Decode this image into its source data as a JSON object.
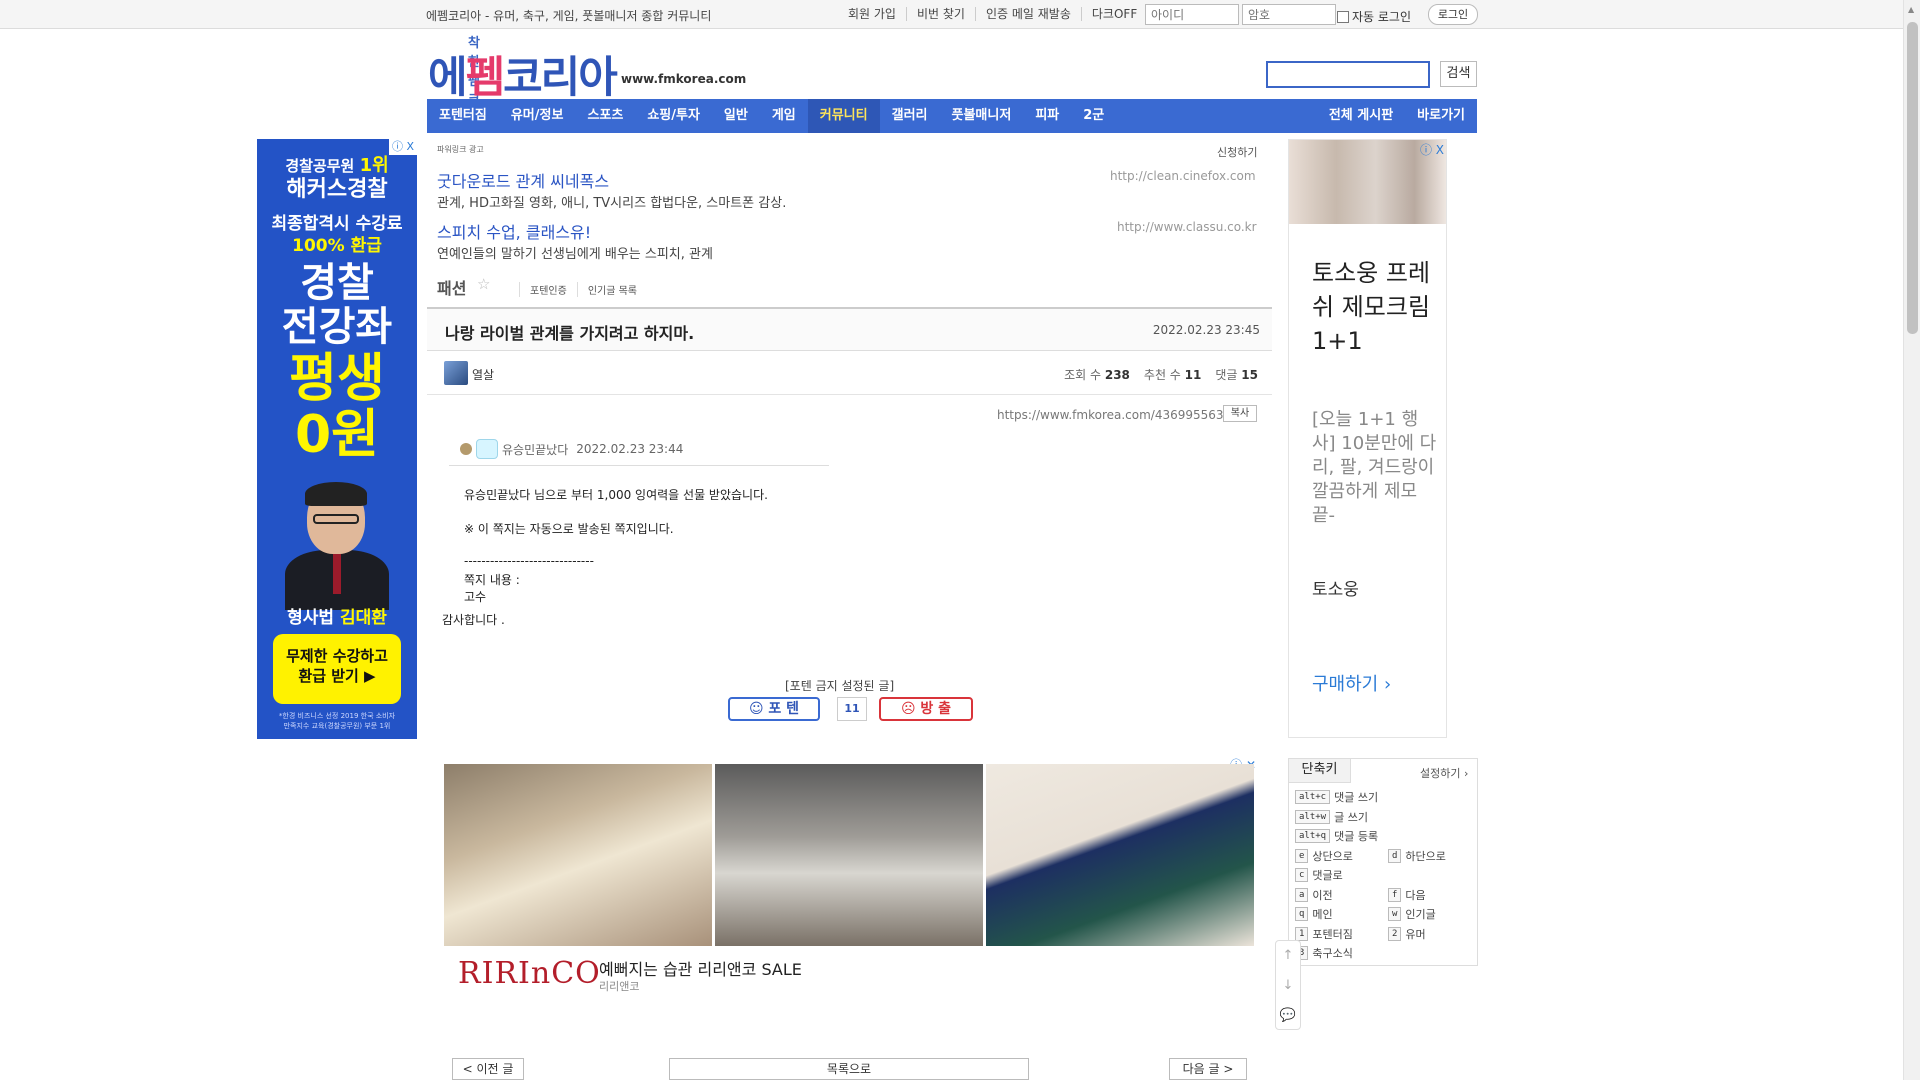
{
  "topbar": {
    "site_desc": "에펨코리아 - 유머, 축구, 게임, 풋볼매니저 종합 커뮤니티",
    "links": [
      "회원 가입",
      "비번 찾기",
      "인증 메일 재발송",
      "다크OFF"
    ],
    "id_placeholder": "아이디",
    "pw_placeholder": "암호",
    "autologin": "자동 로그인",
    "login": "로그인"
  },
  "logo": {
    "sub": "착한 펨코",
    "main_a": "에",
    "main_b": "펨",
    "main_c": "코리아",
    "url": "www.fmkorea.com"
  },
  "search": {
    "button": "검색"
  },
  "nav": {
    "items": [
      "포텐터짐",
      "유머/정보",
      "스포츠",
      "쇼핑/투자",
      "일반",
      "게임",
      "커뮤니티",
      "갤러리",
      "풋볼매니저",
      "피파",
      "2군"
    ],
    "active_index": 6,
    "right": [
      "전체 게시판",
      "바로가기"
    ]
  },
  "left_ad": {
    "close": "ⓘ X",
    "line1": "경찰공무원",
    "line1b": "1위",
    "line2": "해커스경찰",
    "line3": "최종합격시 수강료",
    "line4": "100% 환급",
    "line5a": "경찰",
    "line5b": "전강좌",
    "line6a": "평생",
    "line6b": "0원",
    "name_a": "형사법 ",
    "name_b": "김대환",
    "cta_a": "무제한 수강하고",
    "cta_b": "환급 받기 ▶",
    "fine_a": "*한경 비즈니스 선정 2019 한국 소비자",
    "fine_b": "만족지수 교육(경찰공무원) 부문 1위"
  },
  "powerlink": {
    "label": "파워링크 광고",
    "apply": "신청하기",
    "ads": [
      {
        "title": "굿다운로드 관계 씨네폭스",
        "desc": "관계, HD고화질 영화, 애니, TV시리즈 합법다운, 스마트폰 감상.",
        "url": "http://clean.cinefox.com"
      },
      {
        "title": "스피치 수업, 클래스유!",
        "desc": "연예인들의 말하기 선생님에게 배우는 스피치, 관계",
        "url": "http://www.classu.co.kr"
      }
    ]
  },
  "board": {
    "name": "패션",
    "links": [
      "포텐인증",
      "인기글 목록"
    ]
  },
  "post": {
    "title": "나랑 라이벌 관계를 가지려고 하지마.",
    "date": "2022.02.23 23:45",
    "author": "열살",
    "views_label": "조회 수",
    "views": "238",
    "likes_label": "추천 수",
    "likes": "11",
    "comments_label": "댓글",
    "comments": "15",
    "permalink": "https://www.fmkorea.com/4369955632",
    "copy": "복사",
    "msg_sender": "유승민끝났다",
    "msg_date": "2022.02.23 23:44",
    "lines": [
      "유승민끝났다 님으로 부터 1,000 잉여력을 선물 받았습니다.",
      "※ 이 쪽지는 자동으로 발송된 쪽지입니다.",
      "------------------------------",
      "쪽지 내용 :",
      "고수",
      "감사합니다 ."
    ]
  },
  "vote": {
    "label": "[포텐 금지 설정된 글]",
    "up": "포 텐",
    "count": "11",
    "down": "방 출"
  },
  "shop_ad": {
    "logo": "RIRInCO",
    "title": "예뻐지는 습관 리리앤코 SALE",
    "sub": "리리앤코"
  },
  "post_nav": {
    "prev": "< 이전 글",
    "list": "목록으로",
    "next": "다음 글 >"
  },
  "right_ad": {
    "close": "ⓘ X",
    "big": "토소웅 프레쉬 제모크림 1+1",
    "desc": "[오늘 1+1 행사] 10분만에 다리, 팔, 겨드랑이 깔끔하게 제모 끝-",
    "brand": "토소웅",
    "buy": "구매하기 ›"
  },
  "shortcut": {
    "tab": "단축키",
    "setting": "설정하기 ›",
    "rows": [
      {
        "key": "alt+c",
        "label": "댓글 쓰기"
      },
      {
        "key": "alt+w",
        "label": "글 쓰기"
      },
      {
        "key": "alt+q",
        "label": "댓글 등록"
      },
      {
        "key": "e",
        "label": "상단으로",
        "key2": "d",
        "label2": "하단으로"
      },
      {
        "key": "c",
        "label": "댓글로"
      },
      {
        "key": "a",
        "label": "이전",
        "key2": "f",
        "label2": "다음"
      },
      {
        "key": "q",
        "label": "메인",
        "key2": "w",
        "label2": "인기글"
      },
      {
        "key": "1",
        "label": "포텐터짐",
        "key2": "2",
        "label2": "유머"
      },
      {
        "key": "3",
        "label": "축구소식"
      }
    ]
  },
  "float_btns": [
    "↑",
    "↓",
    "💬"
  ]
}
